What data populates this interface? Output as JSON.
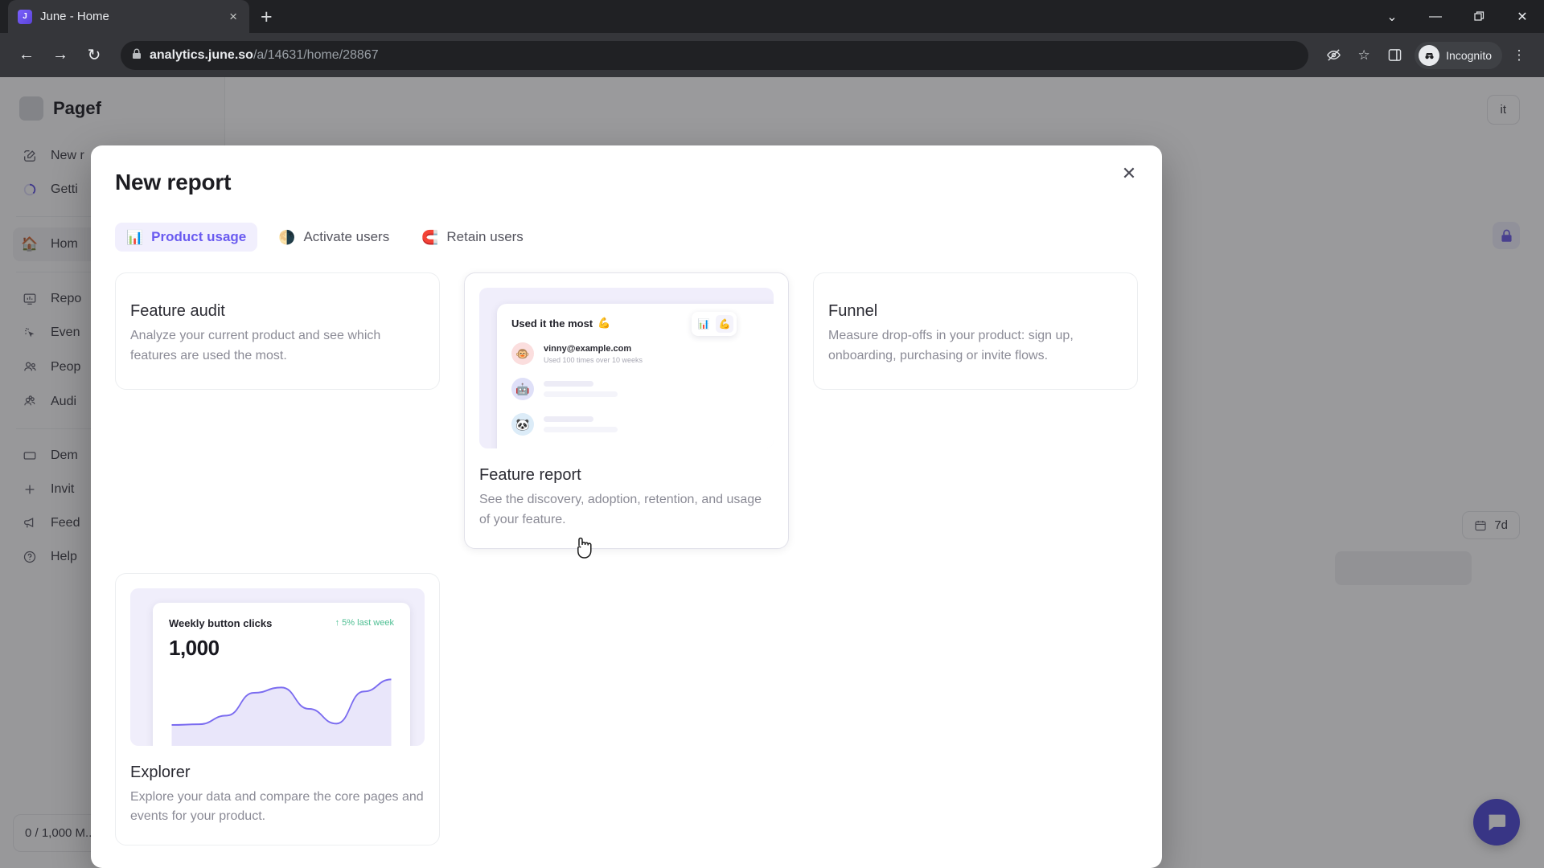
{
  "browser": {
    "tab": {
      "title": "June - Home",
      "favicon": "june-logo-icon",
      "close": "×"
    },
    "new_tab_label": "+",
    "window_controls": {
      "minimize": "—",
      "maximize": "❐",
      "close": "✕",
      "tab_search": "⌄"
    },
    "nav": {
      "back": "←",
      "forward": "→",
      "reload": "↻"
    },
    "omnibox": {
      "lock_icon": "lock-icon",
      "url_host": "analytics.june.so",
      "url_path": "/a/14631/home/28867"
    },
    "actions": {
      "tracking_protection": "🚫",
      "bookmark": "☆",
      "side_panel": "◧",
      "incognito_label": "Incognito",
      "menu": "⋮"
    }
  },
  "app": {
    "workspace": {
      "name": "Pagef"
    },
    "sidebar": [
      {
        "label": "New r",
        "icon": "compose-icon",
        "active": false
      },
      {
        "label": "Getti",
        "icon": "progress-circle-icon",
        "active": false
      },
      {
        "label": "Hom",
        "icon": "house-icon",
        "active": true
      },
      {
        "label": "Repo",
        "icon": "report-icon",
        "active": false
      },
      {
        "label": "Even",
        "icon": "cursor-click-icon",
        "active": false
      },
      {
        "label": "Peop",
        "icon": "people-icon",
        "active": false
      },
      {
        "label": "Audi",
        "icon": "audience-icon",
        "active": false
      },
      {
        "label": "Dem",
        "icon": "demo-icon",
        "active": false
      },
      {
        "label": "Invit",
        "icon": "plus-icon",
        "active": false
      },
      {
        "label": "Feed",
        "icon": "megaphone-icon",
        "active": false
      },
      {
        "label": "Help",
        "icon": "help-icon",
        "active": false
      }
    ],
    "usage": "0 / 1,000 M...",
    "main": {
      "edit_button": "it",
      "lock_icon": "lock-icon",
      "date_range": "7d",
      "intercom_icon": "chat-icon"
    }
  },
  "modal": {
    "title": "New report",
    "close_label": "✕",
    "tabs": [
      {
        "label": "Product usage",
        "icon": "📊",
        "icon_name": "bar-chart-icon",
        "active": true
      },
      {
        "label": "Activate users",
        "icon": "🌗",
        "icon_name": "moon-icon",
        "active": false
      },
      {
        "label": "Retain users",
        "icon": "🧲",
        "icon_name": "magnet-icon",
        "active": false
      }
    ],
    "cards": [
      {
        "id": "feature-audit",
        "title": "Feature audit",
        "description": "Analyze your current product and see which features are used the most.",
        "has_preview": false,
        "selected": false
      },
      {
        "id": "feature-report",
        "title": "Feature report",
        "description": "See the discovery, adoption, retention, and usage of your feature.",
        "has_preview": true,
        "selected": true,
        "preview": {
          "heading": "Used it the most",
          "heading_emoji": "💪",
          "rows": [
            {
              "avatar": "🐵",
              "primary": "vinny@example.com",
              "secondary": "Used 100 times over 10 weeks"
            },
            {
              "avatar": "🤖",
              "primary": "",
              "secondary": ""
            },
            {
              "avatar": "🐼",
              "primary": "",
              "secondary": ""
            }
          ],
          "emoji_picker": [
            "📊",
            "💪"
          ]
        }
      },
      {
        "id": "funnel",
        "title": "Funnel",
        "description": "Measure drop-offs in your product: sign up, onboarding, purchasing or invite flows.",
        "has_preview": false,
        "selected": false
      },
      {
        "id": "explorer",
        "title": "Explorer",
        "description": "Explore your data and compare the core pages and events for your product.",
        "has_preview": true,
        "selected": false,
        "preview": {
          "heading": "Weekly button clicks",
          "delta": "↑ 5% last week",
          "value": "1,000"
        }
      }
    ]
  },
  "chart_data": {
    "type": "area",
    "title": "Weekly button clicks",
    "value_label": "1,000",
    "annotation": "↑ 5% last week",
    "x": [
      0,
      1,
      2,
      3,
      4,
      5,
      6,
      7,
      8
    ],
    "values": [
      180,
      185,
      250,
      420,
      460,
      300,
      190,
      430,
      520
    ],
    "ylim": [
      0,
      600
    ],
    "grid": false,
    "legend": "none",
    "line_color": "#7b6cf0",
    "fill_color": "#e9e6fa"
  },
  "colors": {
    "accent": "#6a5bf0",
    "accent_soft": "#f1effd",
    "preview_bg": "#f0eefb",
    "text_primary": "#2b2b33",
    "text_muted": "#8b8b96",
    "card_border": "#eceef0",
    "chrome_dark": "#202124",
    "chrome_toolbar": "#35363a"
  }
}
